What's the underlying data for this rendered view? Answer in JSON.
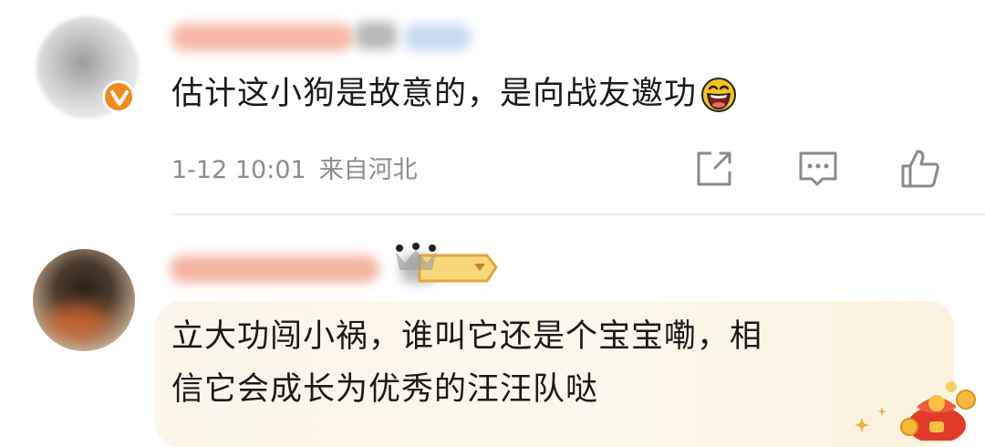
{
  "comments": [
    {
      "text": "估计这小狗是故意的，是向战友邀功",
      "emoji": "laughing-face",
      "time": "1-12 10:01",
      "location": "来自河北",
      "verified": true
    },
    {
      "text_line1": "立大功闯小祸，谁叫它还是个宝宝嘞，相",
      "text_line2": "信它会成长为优秀的汪汪队哒",
      "highlighted": true
    }
  ],
  "colors": {
    "text": "#1a1a1a",
    "meta": "#8c8c8c",
    "verified_badge": "#f38b1c",
    "icon": "#8a8a8a",
    "highlight_bg": "#fbf6e9"
  },
  "icons": [
    "share-icon",
    "reply-icon",
    "like-icon",
    "verified-icon",
    "crown-badge-icon",
    "lucky-bag-icon"
  ]
}
